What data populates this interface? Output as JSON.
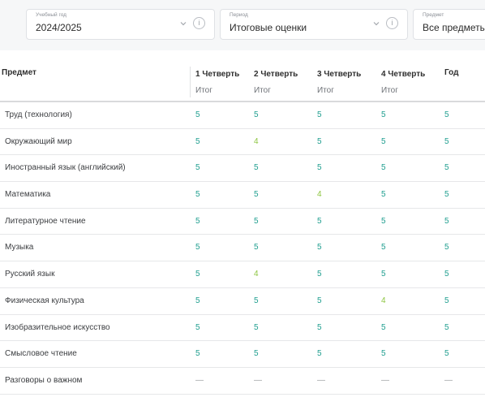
{
  "filters": {
    "year": {
      "label": "Учебный год",
      "value": "2024/2025"
    },
    "period": {
      "label": "Период",
      "value": "Итоговые оценки"
    },
    "subject": {
      "label": "Предмет",
      "value": "Все предметы"
    }
  },
  "table": {
    "subject_header": "Предмет",
    "columns": [
      {
        "label": "1 Четверть",
        "sub": "Итог"
      },
      {
        "label": "2 Четверть",
        "sub": "Итог"
      },
      {
        "label": "3 Четверть",
        "sub": "Итог"
      },
      {
        "label": "4 Четверть",
        "sub": "Итог"
      },
      {
        "label": "Год",
        "sub": ""
      }
    ],
    "rows": [
      {
        "subject": "Труд (технология)",
        "grades": [
          "5",
          "5",
          "5",
          "5",
          "5"
        ]
      },
      {
        "subject": "Окружающий мир",
        "grades": [
          "5",
          "4",
          "5",
          "5",
          "5"
        ]
      },
      {
        "subject": "Иностранный язык (английский)",
        "grades": [
          "5",
          "5",
          "5",
          "5",
          "5"
        ]
      },
      {
        "subject": "Математика",
        "grades": [
          "5",
          "5",
          "4",
          "5",
          "5"
        ]
      },
      {
        "subject": "Литературное чтение",
        "grades": [
          "5",
          "5",
          "5",
          "5",
          "5"
        ]
      },
      {
        "subject": "Музыка",
        "grades": [
          "5",
          "5",
          "5",
          "5",
          "5"
        ]
      },
      {
        "subject": "Русский язык",
        "grades": [
          "5",
          "4",
          "5",
          "5",
          "5"
        ]
      },
      {
        "subject": "Физическая культура",
        "grades": [
          "5",
          "5",
          "5",
          "4",
          "5"
        ]
      },
      {
        "subject": "Изобразительное искусство",
        "grades": [
          "5",
          "5",
          "5",
          "5",
          "5"
        ]
      },
      {
        "subject": "Смысловое чтение",
        "grades": [
          "5",
          "5",
          "5",
          "5",
          "5"
        ]
      },
      {
        "subject": "Разговоры о важном",
        "grades": [
          "—",
          "—",
          "—",
          "—",
          "—"
        ]
      }
    ]
  },
  "icons": {
    "chevron": "chevron-down-icon",
    "info": "info-icon"
  },
  "colors": {
    "grade_5": "#1f9e8f",
    "grade_4": "#8cc53f",
    "dash": "#9a9da2",
    "filter_bg": "#f6f7f8"
  }
}
